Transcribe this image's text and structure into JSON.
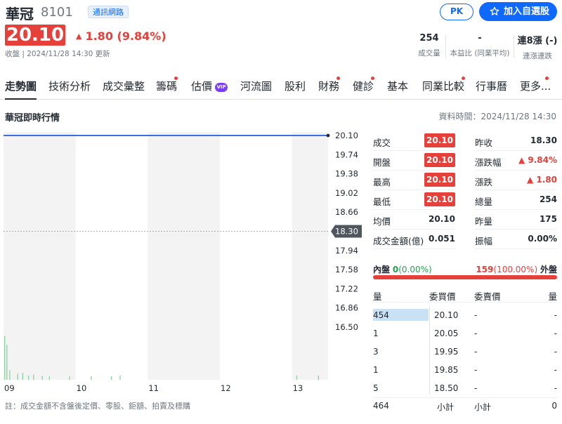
{
  "header": {
    "name": "華冠",
    "code": "8101",
    "industry": "通訊網路",
    "pk_label": "PK",
    "watchlist_label": "加入自選股",
    "price": "20.10",
    "change": "1.80 (9.84%)",
    "status": "收盤 | 2024/11/28 14:30 更新",
    "stats": [
      {
        "value": "254",
        "label": "成交量"
      },
      {
        "value": "-",
        "label": "本益比 (同業平均)"
      },
      {
        "value": "連8漲 (-)",
        "label": "連漲連跌"
      }
    ]
  },
  "tabs": [
    "走勢圖",
    "技術分析",
    "成交彙整",
    "籌碼",
    "估價",
    "河流圖",
    "股利",
    "財務",
    "健診",
    "基本",
    "同業比較",
    "行事曆",
    "更多..."
  ],
  "vip_label": "VIP",
  "section": {
    "title": "華冠即時行情",
    "data_time": "資料時間：2024/11/28 14:30"
  },
  "chart_data": {
    "type": "line",
    "x_ticks": [
      "09",
      "10",
      "11",
      "12",
      "13"
    ],
    "y_ticks": [
      "20.10",
      "19.74",
      "19.38",
      "19.02",
      "18.66",
      "18.30",
      "17.94",
      "17.58",
      "17.22",
      "16.86",
      "16.50"
    ],
    "ylim": [
      16.5,
      20.1
    ],
    "reference_price": 18.3,
    "reference_label": "18.30",
    "price_series": [
      {
        "t": 9.0,
        "p": 20.1
      },
      {
        "t": 13.5,
        "p": 20.1
      }
    ],
    "volume_bars": [
      {
        "t": 9.0,
        "v": 100
      },
      {
        "t": 9.03,
        "v": 80
      },
      {
        "t": 9.07,
        "v": 22
      },
      {
        "t": 9.18,
        "v": 14
      },
      {
        "t": 9.25,
        "v": 16
      },
      {
        "t": 9.33,
        "v": 10
      },
      {
        "t": 9.4,
        "v": 12
      },
      {
        "t": 9.52,
        "v": 9
      },
      {
        "t": 9.62,
        "v": 8
      },
      {
        "t": 9.9,
        "v": 8
      },
      {
        "t": 10.2,
        "v": 8
      },
      {
        "t": 10.48,
        "v": 8
      },
      {
        "t": 10.6,
        "v": 10
      },
      {
        "t": 13.05,
        "v": 10
      },
      {
        "t": 13.35,
        "v": 10
      }
    ],
    "colors": {
      "line": "#3b6fe3",
      "volume": "#8fd4a3",
      "band": "#f3f3f4"
    }
  },
  "quote": {
    "left": [
      {
        "label": "成交",
        "value": "20.10",
        "boxed": true
      },
      {
        "label": "開盤",
        "value": "20.10",
        "boxed": true
      },
      {
        "label": "最高",
        "value": "20.10",
        "boxed": true
      },
      {
        "label": "最低",
        "value": "20.10",
        "boxed": true
      },
      {
        "label": "均價",
        "value": "20.10",
        "boxed": false
      },
      {
        "label": "成交金額(億)",
        "value": "0.051",
        "boxed": false
      }
    ],
    "right": [
      {
        "label": "昨收",
        "value": "18.30",
        "color": "dark"
      },
      {
        "label": "漲跌幅",
        "value": "▲ 9.84%",
        "color": "red"
      },
      {
        "label": "漲跌",
        "value": "▲ 1.80",
        "color": "red"
      },
      {
        "label": "總量",
        "value": "254",
        "color": "dark"
      },
      {
        "label": "昨量",
        "value": "175",
        "color": "dark"
      },
      {
        "label": "振幅",
        "value": "0.00%",
        "color": "dark"
      }
    ]
  },
  "inner_outer": {
    "inner_label": "內盤",
    "inner_value": "0",
    "inner_pct": "(0.00%)",
    "outer_value": "159",
    "outer_pct": "(100.00%)",
    "outer_label": "外盤",
    "outer_share": 1.0
  },
  "order_book": {
    "headers": [
      "量",
      "委買價",
      "委賣價",
      "量"
    ],
    "rows": [
      {
        "bid_vol": "454",
        "bid": "20.10",
        "ask": "-",
        "ask_vol": "-",
        "bar": 1.0
      },
      {
        "bid_vol": "1",
        "bid": "20.05",
        "ask": "-",
        "ask_vol": "-",
        "bar": 0
      },
      {
        "bid_vol": "3",
        "bid": "19.95",
        "ask": "-",
        "ask_vol": "-",
        "bar": 0
      },
      {
        "bid_vol": "1",
        "bid": "19.85",
        "ask": "-",
        "ask_vol": "-",
        "bar": 0
      },
      {
        "bid_vol": "5",
        "bid": "18.50",
        "ask": "-",
        "ask_vol": "-",
        "bar": 0
      }
    ],
    "subtotal_bid_vol": "464",
    "subtotal_label": "小計",
    "subtotal_ask_vol": "0"
  },
  "footnote": "註：成交金額不含盤後定價、零股、鉅額、拍賣及標購"
}
